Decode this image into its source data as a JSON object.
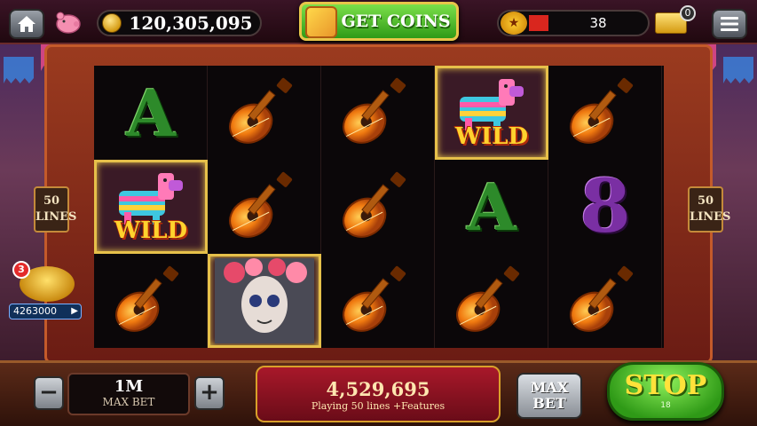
{
  "top_bar": {
    "home_icon": "home-icon",
    "piggy_icon": "piggy-bank-icon",
    "balance": "120,305,095",
    "get_coins_label": "GET COINS",
    "level": "38",
    "ticket_count": "0",
    "menu_icon": "menu-icon"
  },
  "reels": [
    [
      "A",
      "WILD",
      "guitar"
    ],
    [
      "guitar",
      "guitar",
      "calavera"
    ],
    [
      "guitar",
      "guitar",
      "guitar"
    ],
    [
      "WILD",
      "A",
      "guitar"
    ],
    [
      "guitar",
      "8",
      "guitar"
    ]
  ],
  "wild_label": "WILD",
  "lines_left": [
    "50",
    "LINES"
  ],
  "lines_right": [
    "50",
    "LINES"
  ],
  "bonus": {
    "badge": "3",
    "amount": "4263000"
  },
  "bottom_bar": {
    "minus": "−",
    "plus": "+",
    "bet_value": "1M",
    "bet_label": "MAX BET",
    "win_value": "4,529,695",
    "win_label": "Playing 50 lines +Features",
    "maxbet_line1": "MAX",
    "maxbet_line2": "BET",
    "stop_label": "STOP",
    "stop_count": "18"
  },
  "colors": {
    "accent_gold": "#e6c04a",
    "stop_green": "#2f9a17",
    "win_red": "#a8182a"
  }
}
